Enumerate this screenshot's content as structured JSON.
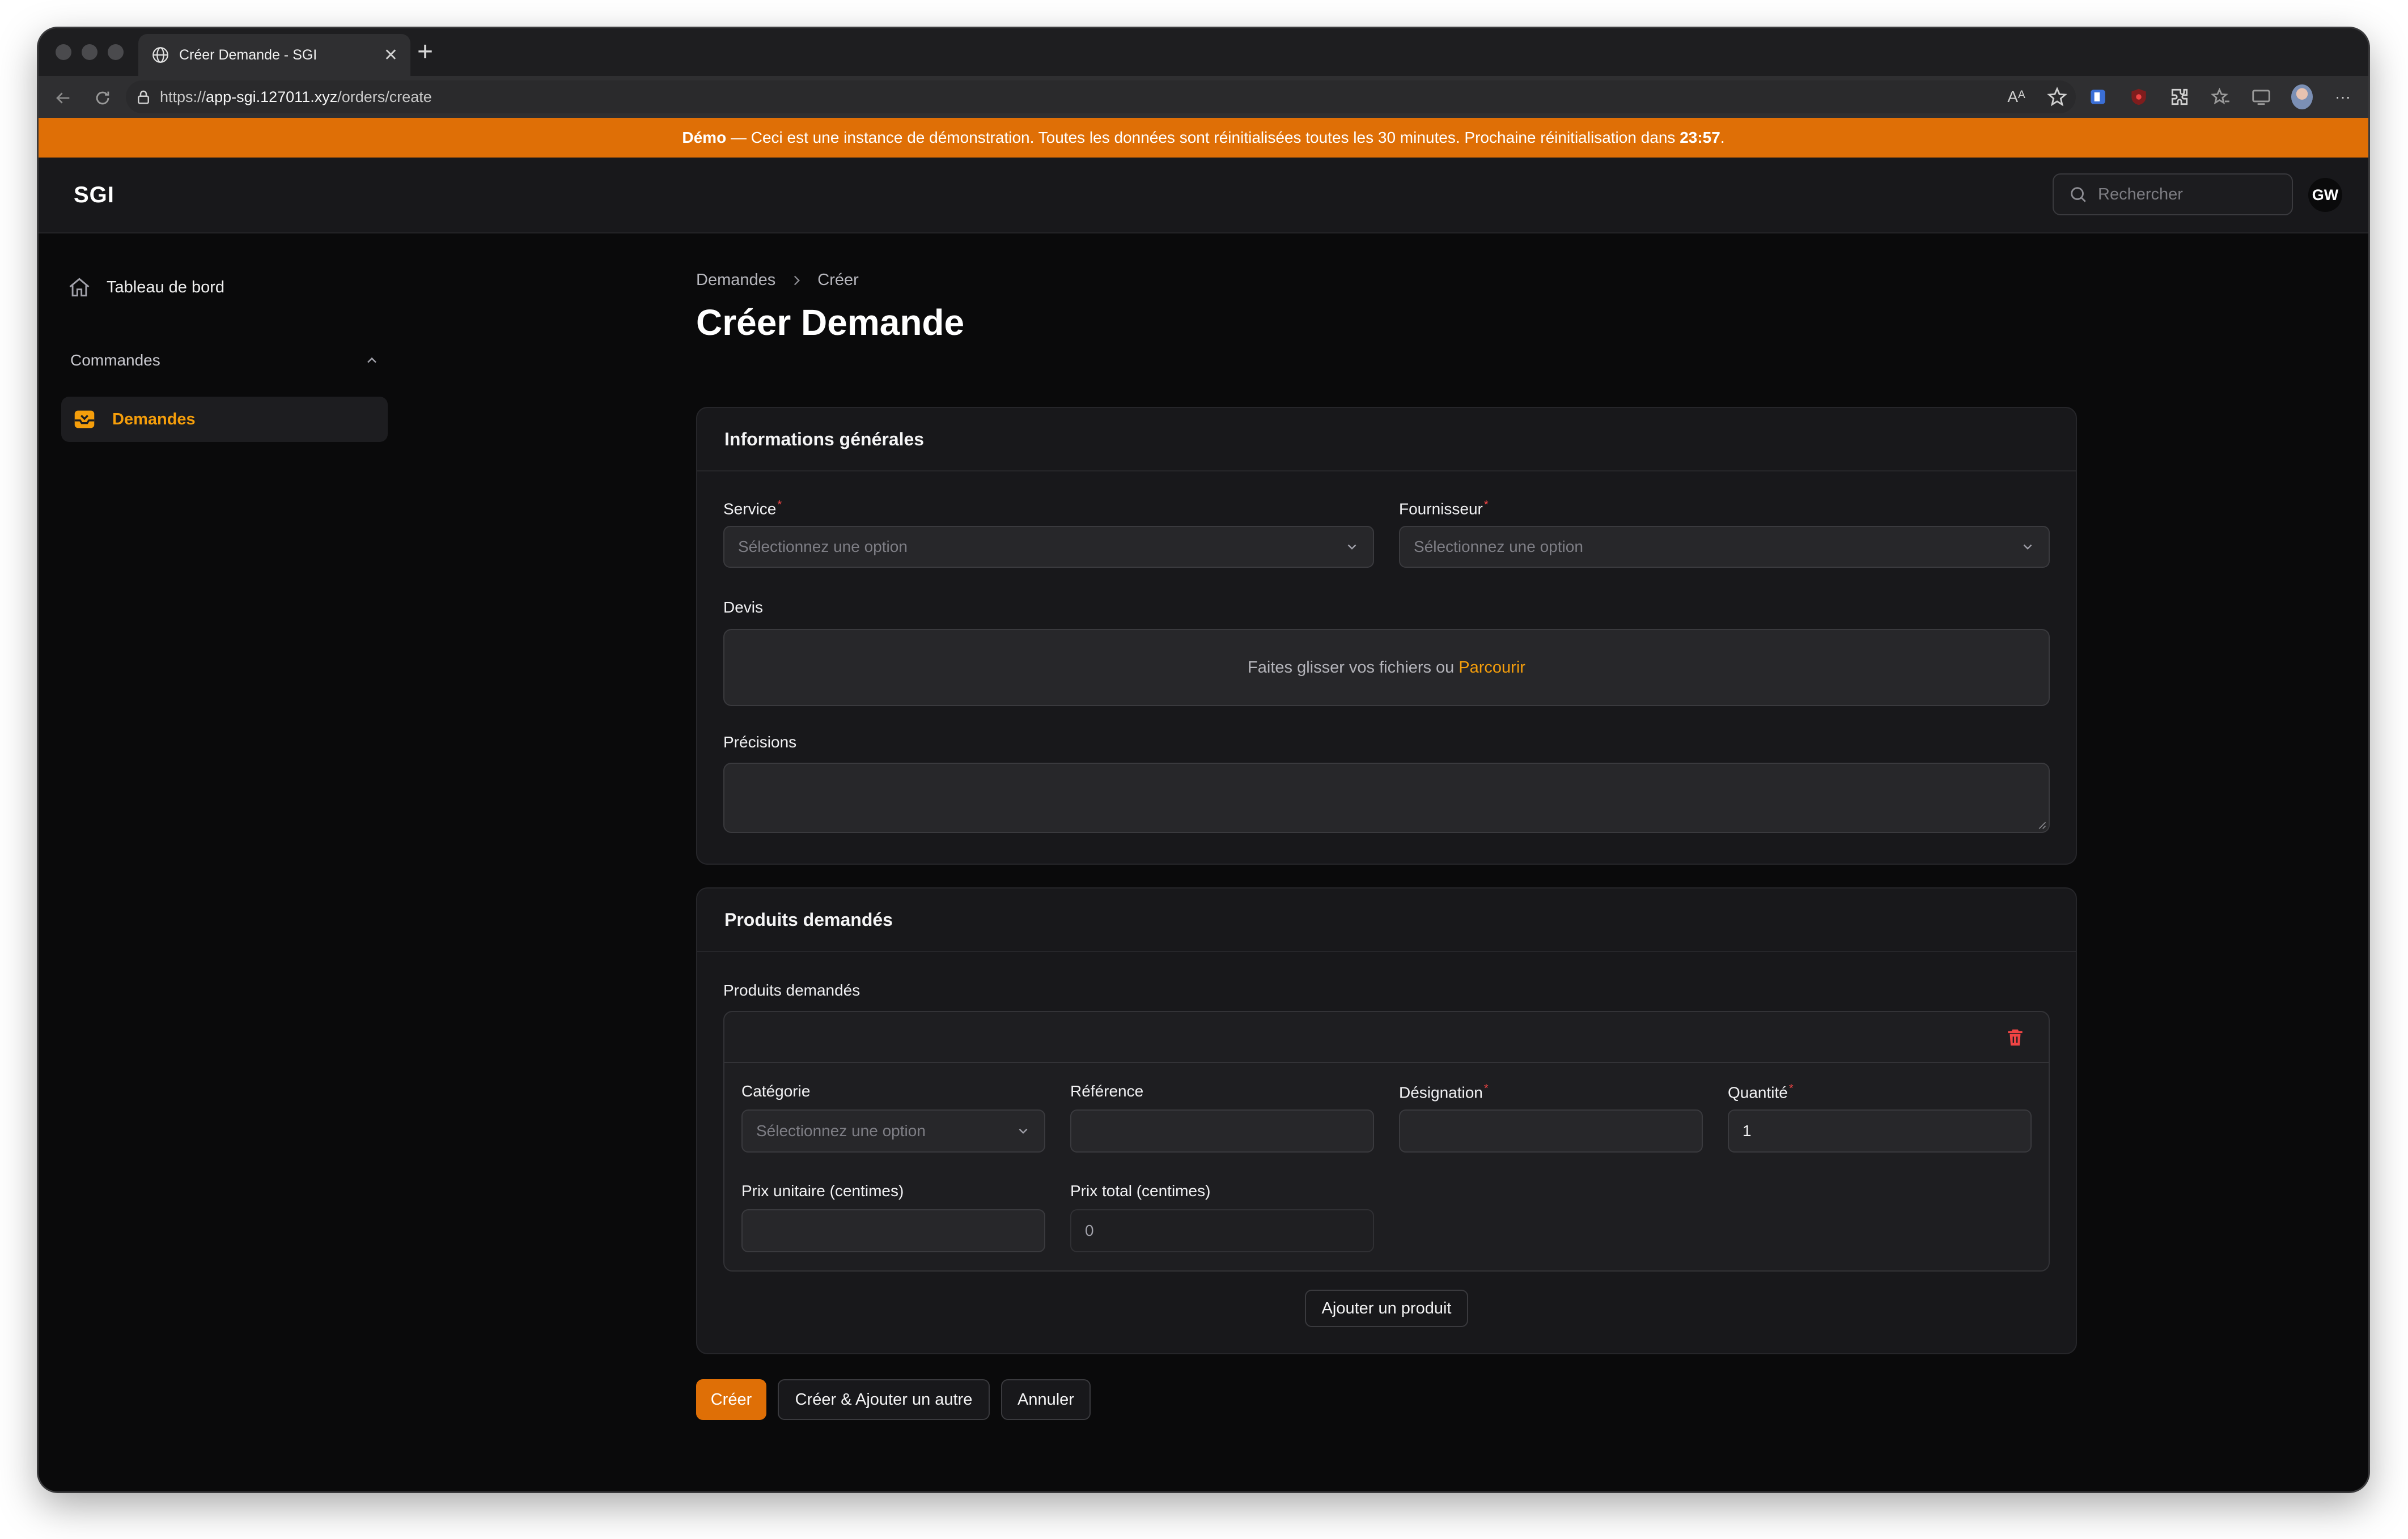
{
  "browser": {
    "tab_title": "Créer Demande - SGI",
    "tab_close": "✕",
    "new_tab": "+",
    "url_prefix": "https://",
    "url_host": "app-sgi.127011.xyz",
    "url_path": "/orders/create",
    "reader_mode": "Aᴬ",
    "more": "···"
  },
  "banner": {
    "label": "Démo",
    "message": " — Ceci est une instance de démonstration. Toutes les données sont réinitialisées toutes les 30 minutes. Prochaine réinitialisation dans ",
    "countdown": "23:57",
    "end": "."
  },
  "topbar": {
    "brand": "SGI",
    "search_placeholder": "Rechercher",
    "user_initials": "GW"
  },
  "sidebar": {
    "dashboard": "Tableau de bord",
    "group": "Commandes",
    "active_item": "Demandes"
  },
  "breadcrumb": {
    "parent": "Demandes",
    "current": "Créer"
  },
  "page_title": "Créer Demande",
  "general": {
    "heading": "Informations générales",
    "service_label": "Service",
    "service_placeholder": "Sélectionnez une option",
    "supplier_label": "Fournisseur",
    "supplier_placeholder": "Sélectionnez une option",
    "quote_label": "Devis",
    "dropzone_text": "Faites glisser vos fichiers ou",
    "dropzone_link": "Parcourir",
    "details_label": "Précisions",
    "details_value": ""
  },
  "products": {
    "heading": "Produits demandés",
    "repeater_label": "Produits demandés",
    "item": {
      "category_label": "Catégorie",
      "category_placeholder": "Sélectionnez une option",
      "reference_label": "Référence",
      "reference_value": "",
      "designation_label": "Désignation",
      "designation_value": "",
      "quantity_label": "Quantité",
      "quantity_value": "1",
      "unit_price_label": "Prix unitaire (centimes)",
      "unit_price_value": "",
      "total_price_label": "Prix total (centimes)",
      "total_price_value": "0"
    },
    "add_button": "Ajouter un produit"
  },
  "required_mark": "*",
  "actions": {
    "create": "Créer",
    "create_another": "Créer & Ajouter un autre",
    "cancel": "Annuler"
  },
  "colors": {
    "accent": "#df6f06",
    "active_nav": "#f59e0b",
    "danger": "#ef4444",
    "background": "#0a0a0b",
    "card": "#18181b"
  }
}
